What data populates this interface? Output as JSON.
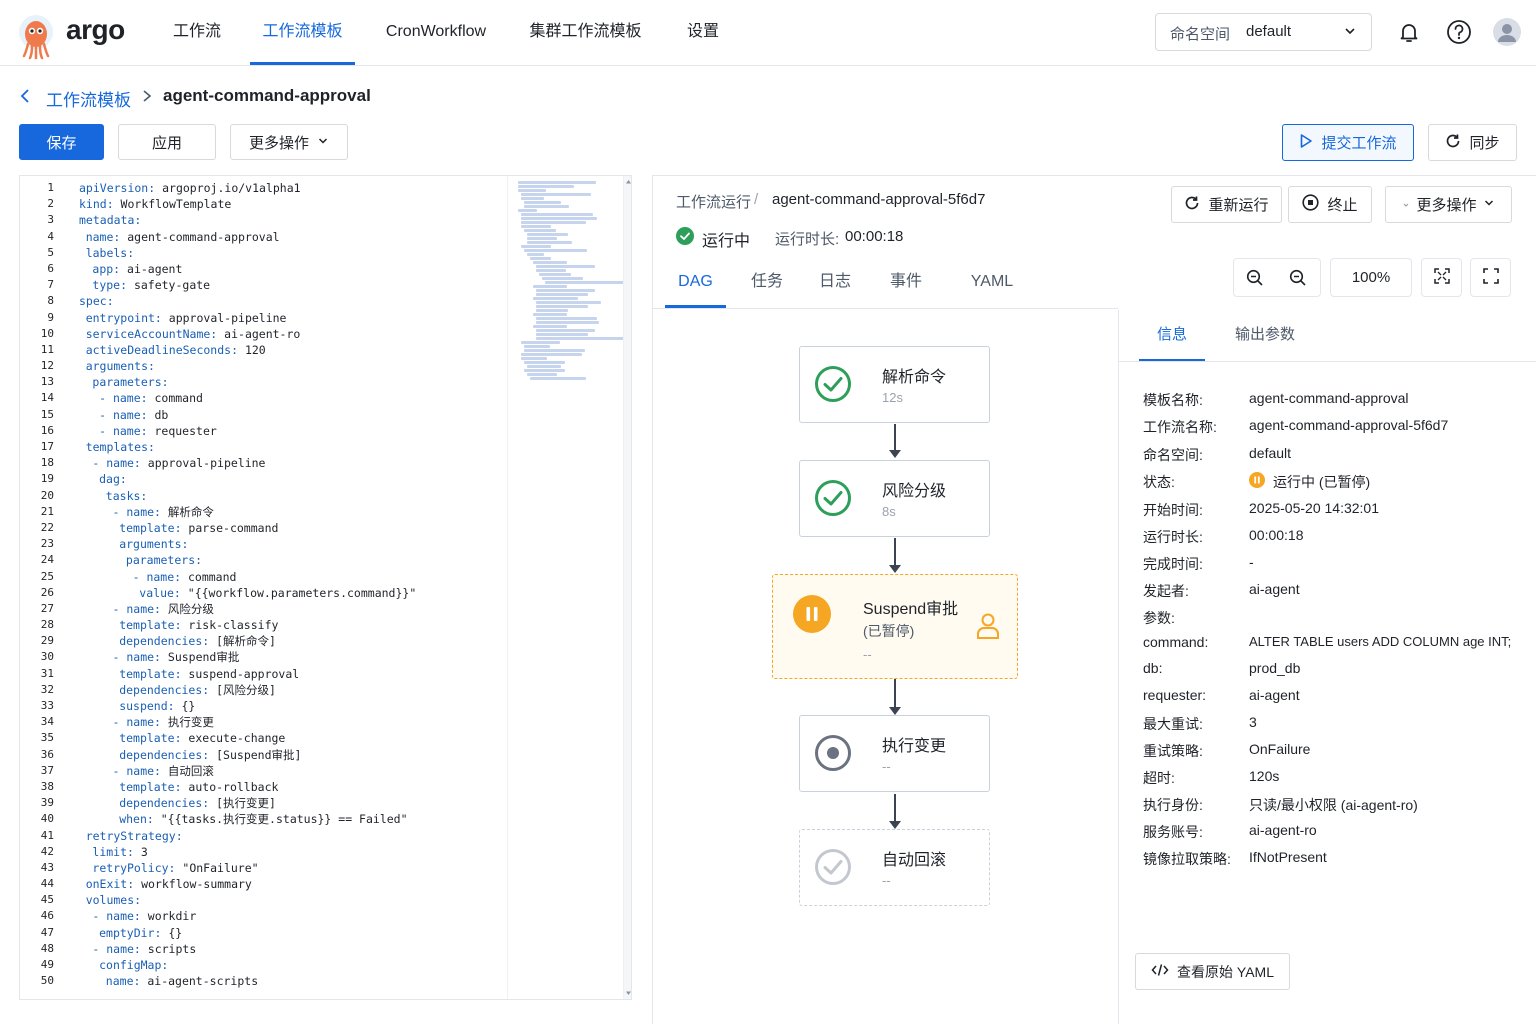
{
  "app": {
    "logo_text": "argo"
  },
  "nav": {
    "items": [
      {
        "label": "工作流"
      },
      {
        "label": "工作流模板"
      },
      {
        "label": "CronWorkflow"
      },
      {
        "label": "集群工作流模板"
      },
      {
        "label": "设置"
      }
    ],
    "active_index": 1
  },
  "namespace": {
    "label": "命名空间",
    "value": "default"
  },
  "breadcrumb": {
    "parent": "工作流模板",
    "current": "agent-command-approval"
  },
  "toolbar": {
    "save": "保存",
    "apply": "应用",
    "more": "更多操作",
    "submit": "提交工作流",
    "sync": "同步"
  },
  "editor": {
    "lines": [
      {
        "n": "1",
        "ind": 0,
        "key": "apiVersion:",
        "val": " argoproj.io/v1alpha1"
      },
      {
        "n": "2",
        "ind": 0,
        "key": "kind:",
        "val": " WorkflowTemplate"
      },
      {
        "n": "3",
        "ind": 0,
        "key": "metadata:",
        "val": ""
      },
      {
        "n": "4",
        "ind": 1,
        "key": "name:",
        "val": " agent-command-approval"
      },
      {
        "n": "5",
        "ind": 1,
        "key": "labels:",
        "val": ""
      },
      {
        "n": "6",
        "ind": 2,
        "key": "app:",
        "val": " ai-agent"
      },
      {
        "n": "7",
        "ind": 2,
        "key": "type:",
        "val": " safety-gate"
      },
      {
        "n": "8",
        "ind": 0,
        "key": "spec:",
        "val": ""
      },
      {
        "n": "9",
        "ind": 1,
        "key": "entrypoint:",
        "val": " approval-pipeline"
      },
      {
        "n": "10",
        "ind": 1,
        "key": "serviceAccountName:",
        "val": " ai-agent-ro"
      },
      {
        "n": "11",
        "ind": 1,
        "key": "activeDeadlineSeconds:",
        "val": " 120"
      },
      {
        "n": "12",
        "ind": 1,
        "key": "arguments:",
        "val": ""
      },
      {
        "n": "13",
        "ind": 2,
        "key": "parameters:",
        "val": ""
      },
      {
        "n": "14",
        "ind": 3,
        "key": "- name:",
        "val": " command"
      },
      {
        "n": "15",
        "ind": 3,
        "key": "- name:",
        "val": " db"
      },
      {
        "n": "16",
        "ind": 3,
        "key": "- name:",
        "val": " requester"
      },
      {
        "n": "17",
        "ind": 1,
        "key": "templates:",
        "val": ""
      },
      {
        "n": "18",
        "ind": 2,
        "key": "- name:",
        "val": " approval-pipeline"
      },
      {
        "n": "19",
        "ind": 3,
        "key": "dag:",
        "val": ""
      },
      {
        "n": "20",
        "ind": 4,
        "key": "tasks:",
        "val": ""
      },
      {
        "n": "21",
        "ind": 5,
        "key": "- name:",
        "val": " 解析命令"
      },
      {
        "n": "22",
        "ind": 6,
        "key": "template:",
        "val": " parse-command"
      },
      {
        "n": "23",
        "ind": 6,
        "key": "arguments:",
        "val": ""
      },
      {
        "n": "24",
        "ind": 7,
        "key": "parameters:",
        "val": ""
      },
      {
        "n": "25",
        "ind": 8,
        "key": "- name:",
        "val": " command"
      },
      {
        "n": "26",
        "ind": 9,
        "key": "value:",
        "val": " \"{{workflow.parameters.command}}\""
      },
      {
        "n": "27",
        "ind": 5,
        "key": "- name:",
        "val": " 风险分级"
      },
      {
        "n": "28",
        "ind": 6,
        "key": "template:",
        "val": " risk-classify"
      },
      {
        "n": "29",
        "ind": 6,
        "key": "dependencies:",
        "val": " [解析命令]"
      },
      {
        "n": "30",
        "ind": 5,
        "key": "- name:",
        "val": " Suspend审批"
      },
      {
        "n": "31",
        "ind": 6,
        "key": "template:",
        "val": " suspend-approval"
      },
      {
        "n": "32",
        "ind": 6,
        "key": "dependencies:",
        "val": " [风险分级]"
      },
      {
        "n": "33",
        "ind": 6,
        "key": "suspend:",
        "val": " {}"
      },
      {
        "n": "34",
        "ind": 5,
        "key": "- name:",
        "val": " 执行变更"
      },
      {
        "n": "35",
        "ind": 6,
        "key": "template:",
        "val": " execute-change"
      },
      {
        "n": "36",
        "ind": 6,
        "key": "dependencies:",
        "val": " [Suspend审批]"
      },
      {
        "n": "37",
        "ind": 5,
        "key": "- name:",
        "val": " 自动回滚"
      },
      {
        "n": "38",
        "ind": 6,
        "key": "template:",
        "val": " auto-rollback"
      },
      {
        "n": "39",
        "ind": 6,
        "key": "dependencies:",
        "val": " [执行变更]"
      },
      {
        "n": "40",
        "ind": 6,
        "key": "when:",
        "val": " \"{{tasks.执行变更.status}} == Failed\""
      },
      {
        "n": "41",
        "ind": 1,
        "key": "retryStrategy:",
        "val": ""
      },
      {
        "n": "42",
        "ind": 2,
        "key": "limit:",
        "val": " 3"
      },
      {
        "n": "43",
        "ind": 2,
        "key": "retryPolicy:",
        "val": " \"OnFailure\""
      },
      {
        "n": "44",
        "ind": 1,
        "key": "onExit:",
        "val": " workflow-summary"
      },
      {
        "n": "45",
        "ind": 1,
        "key": "volumes:",
        "val": ""
      },
      {
        "n": "46",
        "ind": 2,
        "key": "- name:",
        "val": " workdir"
      },
      {
        "n": "47",
        "ind": 3,
        "key": "emptyDir:",
        "val": " {}"
      },
      {
        "n": "48",
        "ind": 2,
        "key": "- name:",
        "val": " scripts"
      },
      {
        "n": "49",
        "ind": 3,
        "key": "configMap:",
        "val": ""
      },
      {
        "n": "50",
        "ind": 4,
        "key": "name:",
        "val": " ai-agent-scripts"
      }
    ]
  },
  "run": {
    "breadcrumb_parent": "工作流运行",
    "breadcrumb_sep": "/",
    "name": "agent-command-approval-5f6d7",
    "status": "运行中",
    "duration_label": "运行时长:",
    "duration": "00:00:18",
    "rerun": "重新运行",
    "terminate": "终止",
    "more": "更多操作",
    "tabs": [
      "DAG",
      "任务",
      "日志",
      "事件",
      "YAML"
    ],
    "zoom": "100%"
  },
  "dag": {
    "nodes": [
      {
        "title": "解析命令",
        "sub": "12s",
        "state": "success"
      },
      {
        "title": "风险分级",
        "sub": "8s",
        "state": "success"
      },
      {
        "title": "Suspend审批",
        "sub": "(已暂停)",
        "extra": "--",
        "state": "suspended"
      },
      {
        "title": "执行变更",
        "sub": "--",
        "state": "pending"
      },
      {
        "title": "自动回滚",
        "sub": "--",
        "state": "skipped"
      }
    ]
  },
  "info": {
    "tabs": [
      "信息",
      "输出参数"
    ],
    "rows": [
      {
        "label": "模板名称:",
        "value": "agent-command-approval"
      },
      {
        "label": "工作流名称:",
        "value": "agent-command-approval-5f6d7"
      },
      {
        "label": "命名空间:",
        "value": "default"
      },
      {
        "label": "状态:",
        "value": "运行中 (已暂停)"
      },
      {
        "label": "开始时间:",
        "value": "2025-05-20 14:32:01"
      },
      {
        "label": "运行时长:",
        "value": "00:00:18"
      },
      {
        "label": "完成时间:",
        "value": "-"
      },
      {
        "label": "发起者:",
        "value": "ai-agent"
      },
      {
        "label": "参数:",
        "value": ""
      },
      {
        "label": "command:",
        "value": "ALTER TABLE users ADD COLUMN age INT;"
      },
      {
        "label": "db:",
        "value": "prod_db"
      },
      {
        "label": "requester:",
        "value": "ai-agent"
      },
      {
        "label": "最大重试:",
        "value": "3"
      },
      {
        "label": "重试策略:",
        "value": "OnFailure"
      },
      {
        "label": "超时:",
        "value": "120s"
      },
      {
        "label": "执行身份:",
        "value": "只读/最小权限 (ai-agent-ro)"
      },
      {
        "label": "服务账号:",
        "value": "ai-agent-ro"
      },
      {
        "label": "镜像拉取策略:",
        "value": "IfNotPresent"
      }
    ],
    "view_yaml": "查看原始 YAML"
  },
  "colors": {
    "accent": "#1668dc",
    "success": "#2e9e5b",
    "warning": "#f5a623",
    "border": "#e5e6eb"
  }
}
